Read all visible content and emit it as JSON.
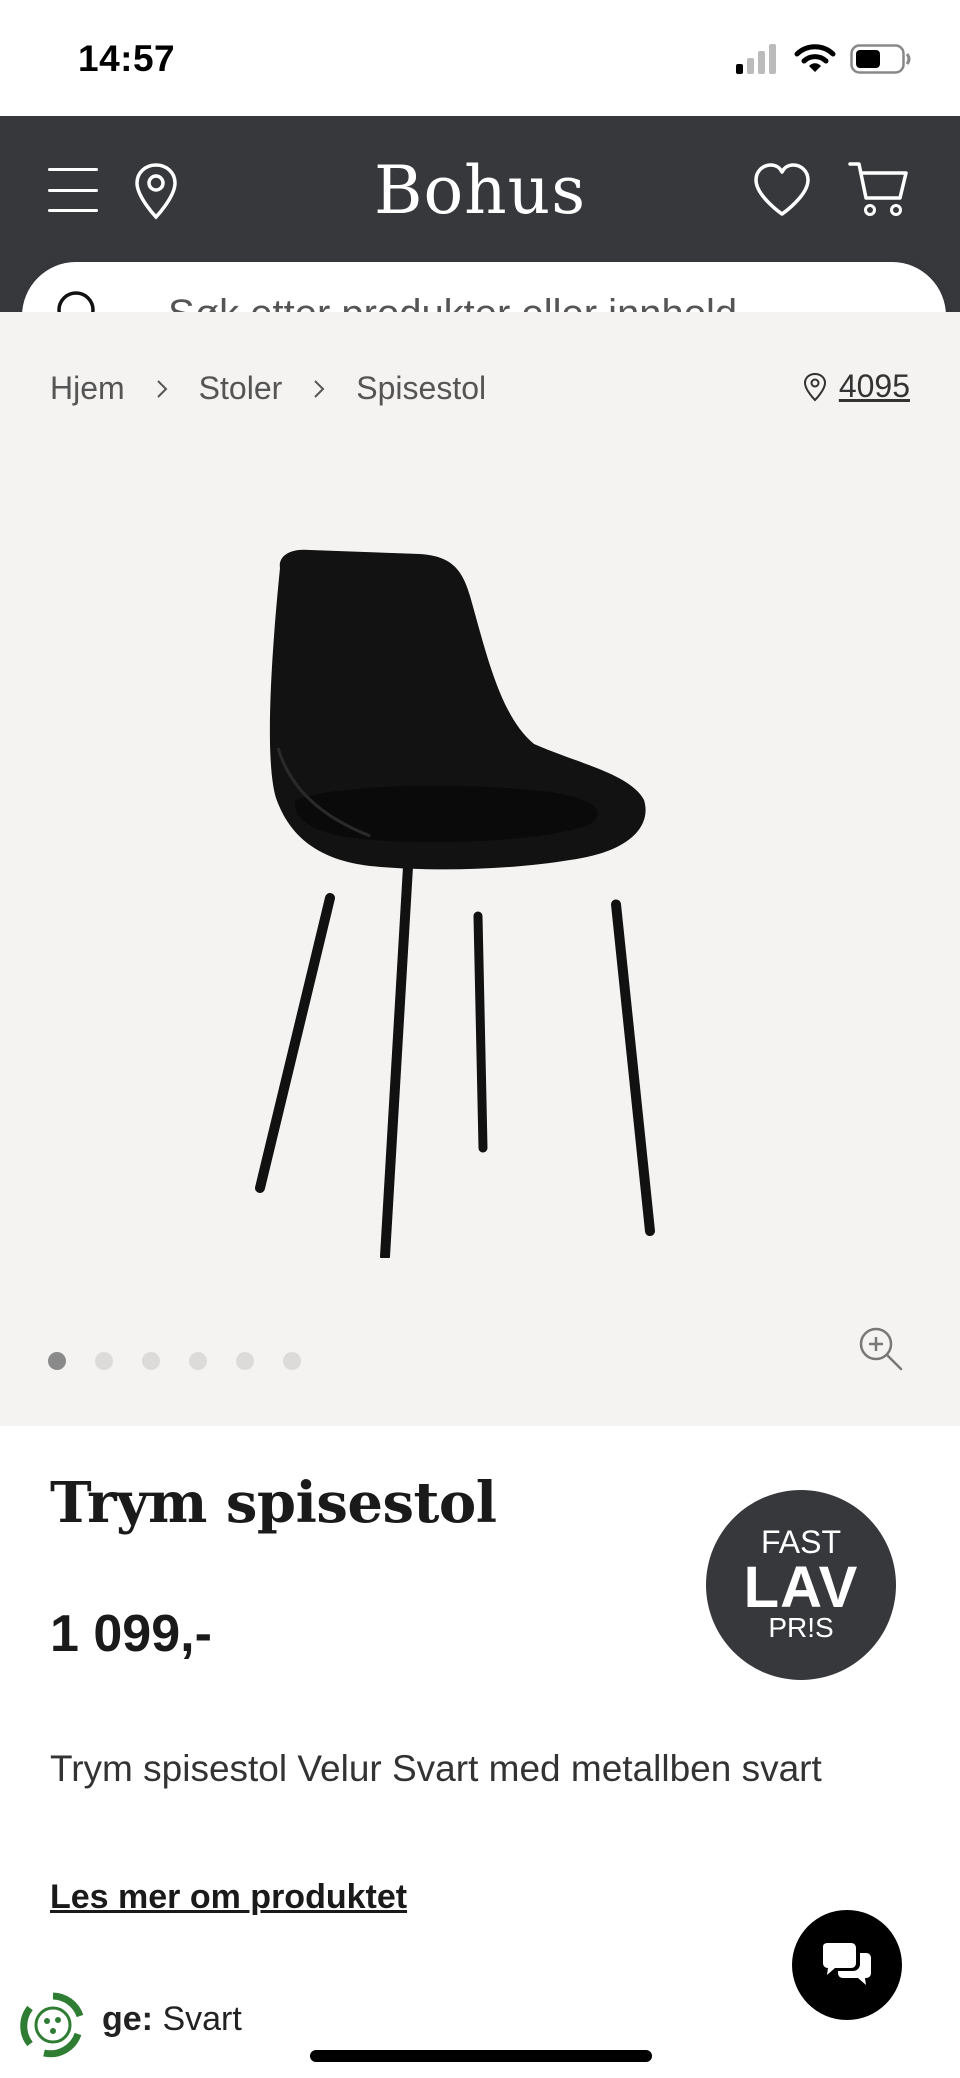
{
  "status_bar": {
    "time": "14:57"
  },
  "header": {
    "logo": "Bohus"
  },
  "search": {
    "placeholder": "Søk etter produkter eller innhold..."
  },
  "breadcrumb": {
    "items": [
      "Hjem",
      "Stoler",
      "Spisestol"
    ]
  },
  "store": {
    "postcode": "4095"
  },
  "gallery": {
    "image_count": 6,
    "active_index": 0
  },
  "product": {
    "title": "Trym spisestol",
    "price": "1 099,-",
    "description": "Trym spisestol Velur Svart med metallben svart",
    "read_more": "Les mer om produktet"
  },
  "badge": {
    "line1": "FAST",
    "line2": "LAV",
    "line3": "PR!S"
  },
  "variant": {
    "label": "ge:",
    "value": "Svart"
  },
  "colors": {
    "header_bg": "#37383c",
    "gallery_bg": "#f4f3f2",
    "chat_bg": "#000000",
    "eco_green": "#2e7d32"
  }
}
